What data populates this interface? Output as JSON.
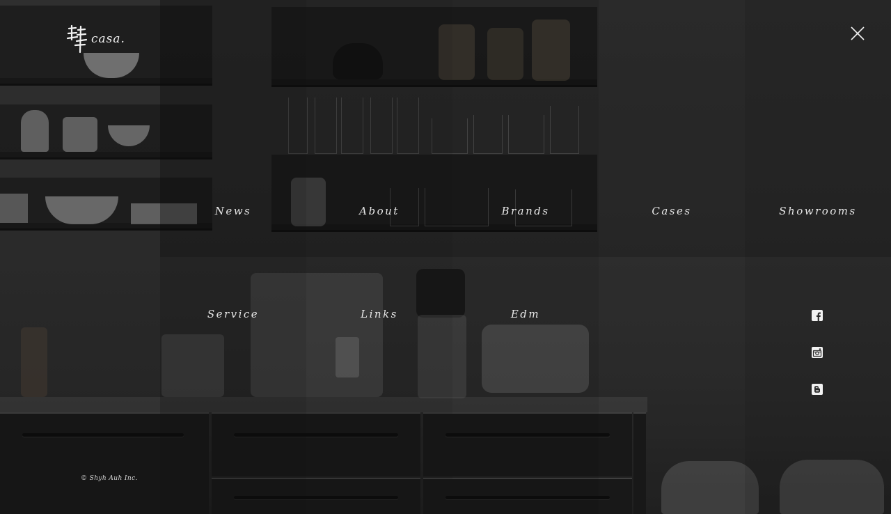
{
  "brand": {
    "logo_text": "casa.",
    "logo_glyph": "肆",
    "logo_icon": "brand-calligraphy-logo"
  },
  "header": {
    "close_icon": "close-icon"
  },
  "menu": {
    "items": [
      {
        "label": "News"
      },
      {
        "label": "About"
      },
      {
        "label": "Brands"
      },
      {
        "label": "Cases"
      },
      {
        "label": "Showrooms"
      },
      {
        "label": "Service"
      },
      {
        "label": "Links"
      },
      {
        "label": "Edm"
      }
    ]
  },
  "social": {
    "items": [
      {
        "icon": "facebook-icon"
      },
      {
        "icon": "instagram-icon"
      },
      {
        "icon": "blogger-icon"
      }
    ]
  },
  "footer": {
    "copyright": "© Shyh Auh Inc."
  },
  "colors": {
    "text": "#e8e8e8",
    "background": "#2a2a2a"
  }
}
